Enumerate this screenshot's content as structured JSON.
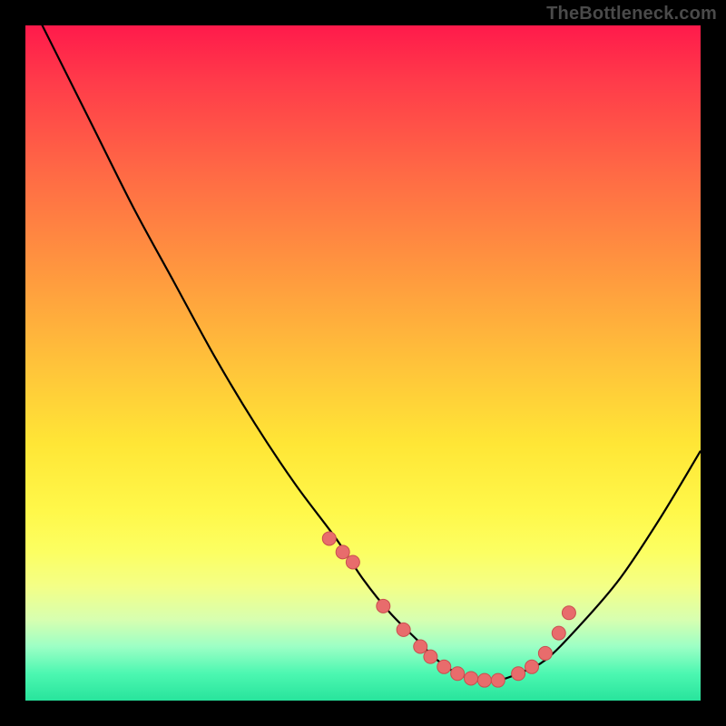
{
  "watermark": "TheBottleneck.com",
  "chart_data": {
    "type": "line",
    "title": "",
    "xlabel": "",
    "ylabel": "",
    "xlim": [
      0,
      100
    ],
    "ylim": [
      0,
      100
    ],
    "series": [
      {
        "name": "bottleneck-curve",
        "x": [
          0,
          4,
          10,
          16,
          22,
          28,
          34,
          40,
          46,
          50,
          54,
          58,
          61,
          64,
          67,
          70,
          73,
          77,
          82,
          88,
          94,
          100
        ],
        "y": [
          105,
          97,
          85,
          73,
          62,
          51,
          41,
          32,
          24,
          18,
          13,
          9,
          6,
          4,
          3,
          3,
          4,
          6,
          11,
          18,
          27,
          37
        ]
      },
      {
        "name": "highlight-dots",
        "x": [
          45,
          47,
          48.5,
          53,
          56,
          58.5,
          60,
          62,
          64,
          66,
          68,
          70,
          73,
          75,
          77,
          79,
          80.5
        ],
        "y": [
          24,
          22,
          20.5,
          14,
          10.5,
          8,
          6.5,
          5,
          4,
          3.3,
          3,
          3,
          4,
          5,
          7,
          10,
          13
        ]
      }
    ],
    "colors": {
      "curve": "#000000",
      "dots_fill": "#e86c6c",
      "dots_stroke": "#c94f4f"
    }
  }
}
